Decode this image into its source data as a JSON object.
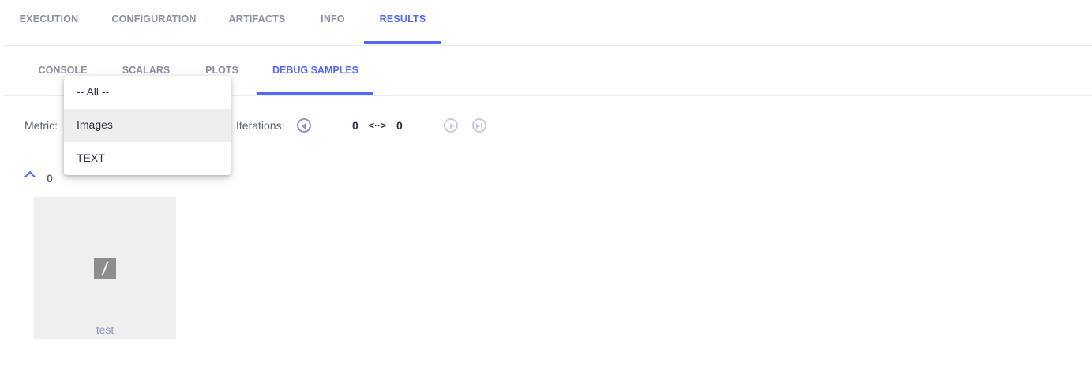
{
  "top_tabs": [
    {
      "label": "EXECUTION",
      "active": false
    },
    {
      "label": "CONFIGURATION",
      "active": false
    },
    {
      "label": "ARTIFACTS",
      "active": false
    },
    {
      "label": "INFO",
      "active": false
    },
    {
      "label": "RESULTS",
      "active": true
    }
  ],
  "sub_tabs": [
    {
      "label": "CONSOLE",
      "active": false
    },
    {
      "label": "SCALARS",
      "active": false
    },
    {
      "label": "PLOTS",
      "active": false
    },
    {
      "label": "DEBUG SAMPLES",
      "active": true
    }
  ],
  "controls": {
    "metric_label": "Metric:",
    "iterations_label": "Iterations:",
    "iteration_from": "0",
    "iteration_separator": "<··>",
    "iteration_to": "0",
    "icons": [
      "previous-iteration-icon",
      "next-iteration-icon",
      "last-iteration-icon"
    ]
  },
  "metric_dropdown": {
    "options": [
      {
        "label": "-- All --",
        "highlighted": false
      },
      {
        "label": "Images",
        "highlighted": true
      },
      {
        "label": "TEXT",
        "highlighted": false
      }
    ]
  },
  "group": {
    "label": "0",
    "icon": "chevron-up-icon"
  },
  "samples": [
    {
      "label": "test"
    }
  ],
  "colors": {
    "accent": "#5468ff",
    "tab_inactive": "#8a90a3",
    "card_bg": "#efefef"
  }
}
